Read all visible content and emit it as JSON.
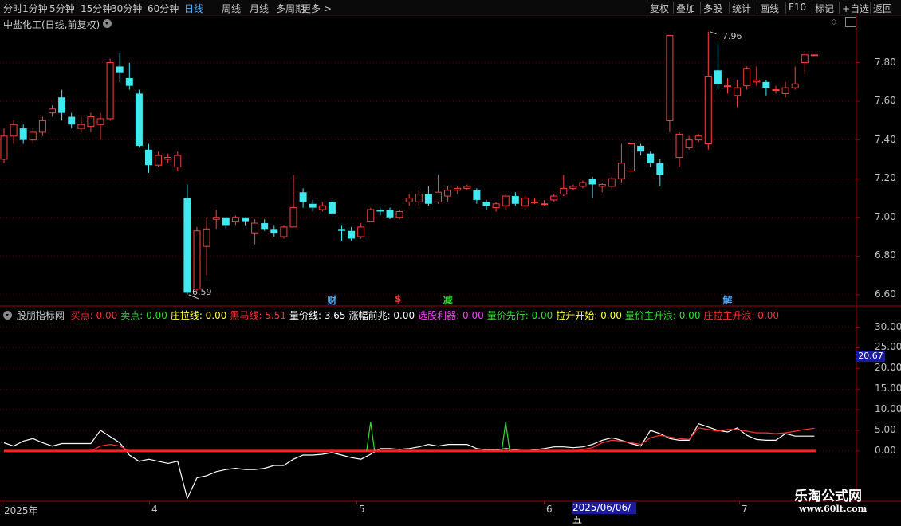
{
  "toolbar": {
    "periods": [
      "分时",
      "1分钟",
      "5分钟",
      "15分钟",
      "30分钟",
      "60分钟",
      "日线",
      "周线",
      "月线",
      "多周期",
      "更多"
    ],
    "active_period": "日线",
    "right_buttons": [
      "复权",
      "叠加",
      "多股",
      "统计",
      "画线",
      "F10",
      "标记",
      "+自选",
      "返回"
    ]
  },
  "main": {
    "title": "中盐化工(日线,前复权)",
    "price_axis": [
      "7.80",
      "7.60",
      "7.40",
      "7.20",
      "7.00",
      "6.80",
      "6.60"
    ],
    "high_label": "7.96",
    "low_label": "6.59",
    "markers": [
      {
        "text": "财",
        "color": "#4aa8ff"
      },
      {
        "text": "$",
        "color": "#ff3030"
      },
      {
        "text": "减",
        "color": "#30e030"
      },
      {
        "text": "解",
        "color": "#4aa8ff"
      }
    ],
    "colors": {
      "up": "#ff4040",
      "down": "#40e8f0",
      "grid": "#5a0000"
    }
  },
  "indicator": {
    "name": "股朋指标网",
    "items": [
      {
        "label": "买点: 0.00",
        "color": "#ff3030"
      },
      {
        "label": "卖点: 0.00",
        "color": "#30e030"
      },
      {
        "label": "庄拉线: 0.00",
        "color": "#ffff40"
      },
      {
        "label": "黑马线: 5.51",
        "color": "#ff3030"
      },
      {
        "label": "量价线: 3.65",
        "color": "#ffffff"
      },
      {
        "label": "涨幅前兆: 0.00",
        "color": "#ffffff"
      },
      {
        "label": "选股利器: 0.00",
        "color": "#ff40ff"
      },
      {
        "label": "量价先行: 0.00",
        "color": "#30e030"
      },
      {
        "label": "拉升开始: 0.00",
        "color": "#ffff40"
      },
      {
        "label": "量价主升浪: 0.00",
        "color": "#30e030"
      },
      {
        "label": "庄拉主升浪: 0.00",
        "color": "#ff3030"
      }
    ],
    "axis": [
      "30.00",
      "25.00",
      "20.00",
      "15.00",
      "10.00",
      "5.00",
      "0.00"
    ],
    "current_value": "20.67"
  },
  "xaxis": {
    "labels": [
      "2025年",
      "4",
      "5",
      "6",
      "7"
    ],
    "date_box": "2025/06/06/五"
  },
  "watermark": {
    "title": "乐淘公式网",
    "url": "www.60lt.com"
  },
  "chart_data": {
    "type": "candlestick",
    "title": "中盐化工(日线,前复权)",
    "ylim": [
      6.55,
      8.0
    ],
    "x_month_labels": [
      "2025年",
      "4",
      "5",
      "6",
      "7"
    ],
    "candles": [
      [
        7.3,
        7.42,
        7.46,
        7.28
      ],
      [
        7.42,
        7.48,
        7.5,
        7.38
      ],
      [
        7.46,
        7.4,
        7.48,
        7.38
      ],
      [
        7.4,
        7.44,
        7.46,
        7.38
      ],
      [
        7.44,
        7.5,
        7.52,
        7.42
      ],
      [
        7.54,
        7.56,
        7.58,
        7.52
      ],
      [
        7.62,
        7.54,
        7.66,
        7.5
      ],
      [
        7.52,
        7.48,
        7.54,
        7.46
      ],
      [
        7.46,
        7.48,
        7.52,
        7.44
      ],
      [
        7.47,
        7.52,
        7.54,
        7.44
      ],
      [
        7.48,
        7.51,
        7.54,
        7.4
      ],
      [
        7.51,
        7.8,
        7.82,
        7.5
      ],
      [
        7.78,
        7.75,
        7.85,
        7.7
      ],
      [
        7.72,
        7.68,
        7.8,
        7.66
      ],
      [
        7.64,
        7.37,
        7.66,
        7.36
      ],
      [
        7.35,
        7.27,
        7.38,
        7.23
      ],
      [
        7.27,
        7.32,
        7.34,
        7.26
      ],
      [
        7.3,
        7.31,
        7.33,
        7.28
      ],
      [
        7.26,
        7.32,
        7.34,
        7.24
      ],
      [
        7.1,
        6.61,
        7.17,
        6.6
      ],
      [
        6.63,
        6.93,
        6.95,
        6.62
      ],
      [
        6.85,
        6.94,
        7.0,
        6.7
      ],
      [
        6.99,
        7.0,
        7.04,
        6.94
      ],
      [
        7.0,
        6.96,
        7.0,
        6.94
      ],
      [
        6.98,
        7.0,
        7.01,
        6.96
      ],
      [
        7.0,
        6.98,
        7.0,
        6.96
      ],
      [
        6.92,
        6.97,
        6.99,
        6.86
      ],
      [
        6.97,
        6.94,
        6.99,
        6.93
      ],
      [
        6.94,
        6.92,
        6.96,
        6.9
      ],
      [
        6.9,
        6.95,
        6.96,
        6.89
      ],
      [
        6.95,
        7.05,
        7.22,
        6.95
      ],
      [
        7.13,
        7.08,
        7.15,
        7.05
      ],
      [
        7.07,
        7.05,
        7.09,
        7.03
      ],
      [
        7.04,
        7.06,
        7.08,
        7.03
      ],
      [
        7.08,
        7.02,
        7.09,
        7.01
      ],
      [
        6.94,
        6.93,
        6.96,
        6.88
      ],
      [
        6.93,
        6.89,
        6.95,
        6.88
      ],
      [
        6.9,
        6.95,
        6.97,
        6.89
      ],
      [
        6.98,
        7.04,
        7.05,
        6.98
      ],
      [
        7.04,
        7.03,
        7.05,
        7.01
      ],
      [
        7.04,
        7.0,
        7.05,
        6.99
      ],
      [
        7.0,
        7.03,
        7.04,
        6.99
      ],
      [
        7.08,
        7.1,
        7.12,
        7.06
      ],
      [
        7.08,
        7.12,
        7.14,
        7.06
      ],
      [
        7.12,
        7.07,
        7.16,
        7.06
      ],
      [
        7.08,
        7.13,
        7.22,
        7.07
      ],
      [
        7.11,
        7.14,
        7.16,
        7.08
      ],
      [
        7.14,
        7.15,
        7.16,
        7.12
      ],
      [
        7.15,
        7.16,
        7.17,
        7.14
      ],
      [
        7.14,
        7.09,
        7.15,
        7.07
      ],
      [
        7.08,
        7.06,
        7.09,
        7.04
      ],
      [
        7.05,
        7.07,
        7.08,
        7.03
      ],
      [
        7.06,
        7.11,
        7.12,
        7.04
      ],
      [
        7.11,
        7.07,
        7.13,
        7.06
      ],
      [
        7.06,
        7.1,
        7.11,
        7.05
      ],
      [
        7.08,
        7.08,
        7.1,
        7.07
      ],
      [
        7.07,
        7.07,
        7.09,
        7.06
      ],
      [
        7.09,
        7.11,
        7.12,
        7.08
      ],
      [
        7.12,
        7.15,
        7.22,
        7.11
      ],
      [
        7.15,
        7.16,
        7.17,
        7.14
      ],
      [
        7.16,
        7.18,
        7.19,
        7.15
      ],
      [
        7.2,
        7.17,
        7.21,
        7.1
      ],
      [
        7.16,
        7.17,
        7.18,
        7.13
      ],
      [
        7.16,
        7.2,
        7.21,
        7.15
      ],
      [
        7.2,
        7.28,
        7.38,
        7.18
      ],
      [
        7.24,
        7.38,
        7.4,
        7.22
      ],
      [
        7.37,
        7.34,
        7.38,
        7.32
      ],
      [
        7.33,
        7.28,
        7.34,
        7.26
      ],
      [
        7.28,
        7.22,
        7.3,
        7.16
      ],
      [
        7.5,
        7.94,
        7.94,
        7.44
      ],
      [
        7.31,
        7.43,
        7.44,
        7.26
      ],
      [
        7.36,
        7.4,
        7.42,
        7.35
      ],
      [
        7.4,
        7.42,
        7.43,
        7.39
      ],
      [
        7.38,
        7.73,
        7.96,
        7.35
      ],
      [
        7.76,
        7.69,
        7.9,
        7.66
      ],
      [
        7.68,
        7.68,
        7.72,
        7.64
      ],
      [
        7.63,
        7.67,
        7.71,
        7.57
      ],
      [
        7.68,
        7.77,
        7.78,
        7.66
      ],
      [
        7.7,
        7.71,
        7.78,
        7.68
      ],
      [
        7.7,
        7.67,
        7.71,
        7.63
      ],
      [
        7.66,
        7.66,
        7.68,
        7.64
      ],
      [
        7.64,
        7.67,
        7.7,
        7.62
      ],
      [
        7.67,
        7.69,
        7.78,
        7.66
      ],
      [
        7.8,
        7.84,
        7.86,
        7.74
      ],
      [
        7.84,
        7.84,
        7.84,
        7.84
      ]
    ],
    "indicator": {
      "name": "股朋指标网",
      "ylim": [
        -12,
        33
      ],
      "series": [
        {
          "name": "量价线",
          "color": "#ffffff",
          "values": [
            2.0,
            1.2,
            2.4,
            3.0,
            2.0,
            1.2,
            1.8,
            1.8,
            1.8,
            1.8,
            5.0,
            3.5,
            2.0,
            -1.0,
            -2.5,
            -2.0,
            -2.5,
            -3.0,
            -2.5,
            -11.5,
            -6.5,
            -6.0,
            -5.0,
            -4.5,
            -4.2,
            -4.5,
            -4.5,
            -4.2,
            -3.5,
            -3.5,
            -2.0,
            -1.0,
            -1.0,
            -0.8,
            -0.4,
            -1.0,
            -1.6,
            -2.0,
            -0.8,
            0.6,
            0.6,
            0.4,
            0.6,
            1.0,
            1.6,
            1.2,
            1.6,
            1.6,
            1.6,
            0.6,
            0.3,
            0.3,
            0.6,
            0.3,
            0.0,
            0.3,
            0.6,
            1.0,
            1.0,
            0.8,
            1.0,
            1.6,
            2.6,
            3.2,
            2.6,
            1.8,
            1.2,
            5.0,
            4.2,
            3.0,
            2.6,
            2.6,
            6.6,
            5.8,
            5.0,
            4.6,
            5.6,
            3.8,
            2.8,
            2.6,
            2.6,
            4.2,
            3.6,
            3.6,
            3.6
          ]
        },
        {
          "name": "黑马线",
          "color": "#ff3030",
          "values": [
            0,
            0,
            0,
            0,
            0,
            0,
            0,
            0,
            0,
            0,
            1.2,
            1.6,
            1.2,
            0,
            0,
            0,
            0,
            0,
            0,
            0,
            0,
            0,
            0,
            0,
            0,
            0,
            0,
            0,
            0,
            0,
            0,
            0,
            0,
            0,
            0,
            0,
            0,
            0,
            0,
            0,
            0,
            0,
            0,
            0,
            0,
            0,
            0,
            0,
            0,
            0,
            0,
            0,
            0,
            0,
            0,
            0,
            0,
            0,
            0,
            0,
            0.4,
            0.8,
            2.0,
            2.6,
            2.4,
            2.0,
            1.6,
            3.2,
            3.8,
            3.4,
            3.0,
            2.8,
            5.6,
            5.2,
            4.8,
            5.2,
            5.2,
            4.8,
            4.4,
            4.4,
            4.2,
            4.4,
            4.8,
            5.2,
            5.5
          ]
        },
        {
          "name": "买点",
          "color": "#ff3030",
          "values": [
            0,
            0
          ]
        },
        {
          "name": "卖点",
          "color": "#30e030",
          "values": [
            0,
            0
          ]
        }
      ],
      "spikes_color": "#30e030"
    }
  }
}
